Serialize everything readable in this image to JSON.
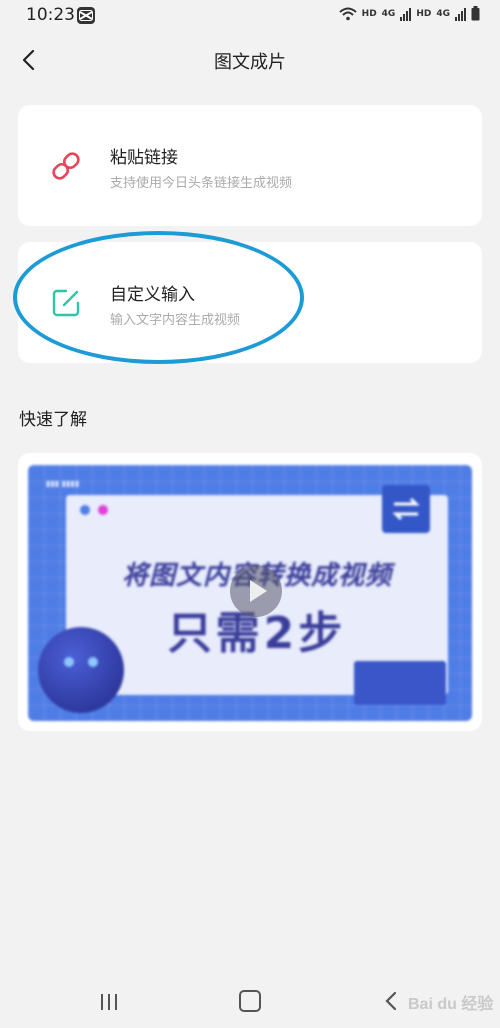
{
  "status": {
    "time": "10:23",
    "hd1": "HD",
    "hd2": "HD",
    "net": "4G"
  },
  "header": {
    "title": "图文成片"
  },
  "cards": {
    "paste": {
      "title": "粘贴链接",
      "subtitle": "支持使用今日头条链接生成视频",
      "icon": "link-icon",
      "icon_color": "#e8445a"
    },
    "custom": {
      "title": "自定义输入",
      "subtitle": "输入文字内容生成视频",
      "icon": "edit-icon",
      "icon_color": "#2ec4a8"
    }
  },
  "quick_learn": {
    "title": "快速了解",
    "thumbnail_line1": "将图文内容转换成视频",
    "thumbnail_line2": "只需2步"
  },
  "watermark": "Bai du 经验",
  "colors": {
    "highlight": "#1d9bd6",
    "thumb_bg": "#4f7de6"
  }
}
